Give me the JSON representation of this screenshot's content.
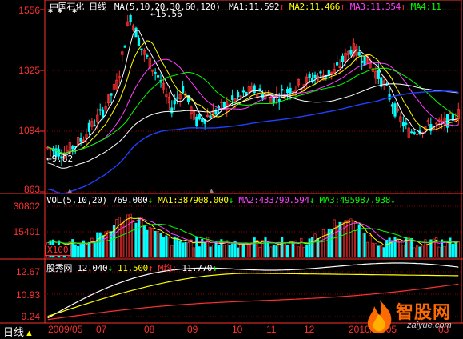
{
  "window": {
    "stock_name": "中国石化",
    "period_label": "日线",
    "ma_params_text": "MA(5,10,20,30,60,120)",
    "ma_lines": [
      {
        "label": "MA1:",
        "value": "11.592",
        "arrow": "↑",
        "color": "#ffffff"
      },
      {
        "label": "MA2:",
        "value": "11.466",
        "arrow": "↑",
        "color": "#ffff00"
      },
      {
        "label": "MA3:",
        "value": "11.354",
        "arrow": "↑",
        "color": "#ff40ff"
      },
      {
        "label": "MA4:",
        "value": "11",
        "arrow": "",
        "color": "#00ff00"
      }
    ],
    "high_annotation": "15.56",
    "low_annotation": "9.82"
  },
  "price_axis": {
    "labels": [
      "1556",
      "1325",
      "1094",
      "863"
    ]
  },
  "volume_pane": {
    "title": "VOL(5,10,20)",
    "vol_value": "769.000",
    "vol_arrow": "↓",
    "ma_values": [
      {
        "label": "MA1:",
        "value": "387908.000",
        "arrow": "↓",
        "color": "#ffff00"
      },
      {
        "label": "MA2:",
        "value": "433790.594",
        "arrow": "↓",
        "color": "#ff40ff"
      },
      {
        "label": "MA3:",
        "value": "495987.938",
        "arrow": "↓",
        "color": "#00ff00"
      }
    ],
    "axis_labels": [
      "30802",
      "15401"
    ],
    "unit_label": "X100"
  },
  "indicator_pane": {
    "title": "股秀网",
    "v1": "12.040",
    "v1_arrow": "↓",
    "v2": "11.500",
    "v2_arrow": "↑",
    "ma_label": "M均:",
    "ma_value": "11.770",
    "ma_arrow": "↓",
    "axis_labels": [
      "12.67",
      "10.93",
      "9.24"
    ]
  },
  "date_axis": {
    "period_button": "日线",
    "ticks": [
      "2009/05",
      "07",
      "08",
      "09",
      "10",
      "11",
      "12",
      "2010/01/05",
      "03"
    ]
  },
  "watermark": {
    "text": "智股网",
    "sub": "zaiyue.com"
  },
  "colors": {
    "up": "#ff3030",
    "down": "#00ffff",
    "axis": "#ff3030",
    "ma1": "#ffffff",
    "ma2": "#ffff00",
    "ma3": "#ff40ff",
    "ma4": "#00ff00",
    "ma5": "#ffffff",
    "ma6": "#2040ff"
  },
  "chart_data": {
    "type": "line",
    "title": "中国石化 日线",
    "ylim": [
      8.63,
      15.56
    ],
    "price_ticks": [
      15.56,
      13.25,
      10.94,
      8.63
    ],
    "x_categories": [
      "2009/05",
      "07",
      "08",
      "09",
      "10",
      "11",
      "12",
      "2010/01/05",
      "03"
    ],
    "series": [
      {
        "name": "MA1",
        "last": 11.592
      },
      {
        "name": "MA2",
        "last": 11.466
      },
      {
        "name": "MA3",
        "last": 11.354
      }
    ],
    "high": 15.56,
    "low": 9.82,
    "volume": {
      "ylim": [
        0,
        30802
      ],
      "ticks": [
        30802,
        15401
      ],
      "last": 769.0,
      "ma": [
        387908.0,
        433790.594,
        495987.938
      ]
    },
    "indicator": {
      "ylim": [
        9.24,
        12.67
      ],
      "ticks": [
        12.67,
        10.93,
        9.24
      ],
      "values": [
        12.04,
        11.5
      ],
      "ma": 11.77
    }
  }
}
